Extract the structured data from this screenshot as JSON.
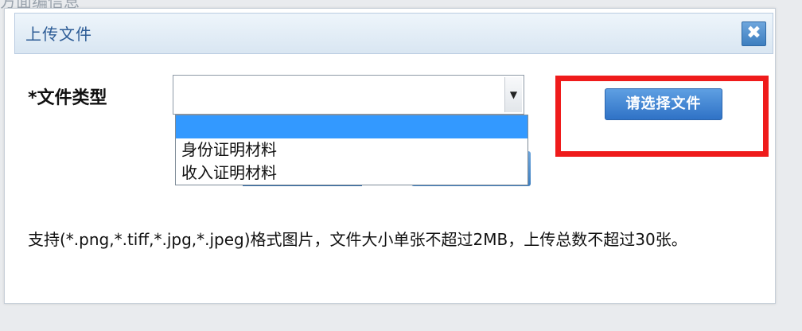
{
  "background": {
    "caption": "方面编信息"
  },
  "dialog": {
    "title": "上传文件",
    "close_label": "✖",
    "file_type_label": "*文件类型",
    "select": {
      "current_value": "",
      "options": [
        "",
        "身份证明材料",
        "收入证明材料"
      ],
      "selected_index": 0,
      "arrow": "▼"
    },
    "choose_file_button": "请选择文件",
    "hint": "支持(*.png,*.tiff,*.jpg,*.jpeg)格式图片，文件大小单张不超过2MB，上传总数不超过30张。"
  },
  "colors": {
    "highlight": "#ef1b1b",
    "accent": "#3399ff",
    "title": "#2d5c96"
  },
  "icons": {
    "close": "close-icon",
    "dropdown_arrow": "chevron-down-icon"
  }
}
